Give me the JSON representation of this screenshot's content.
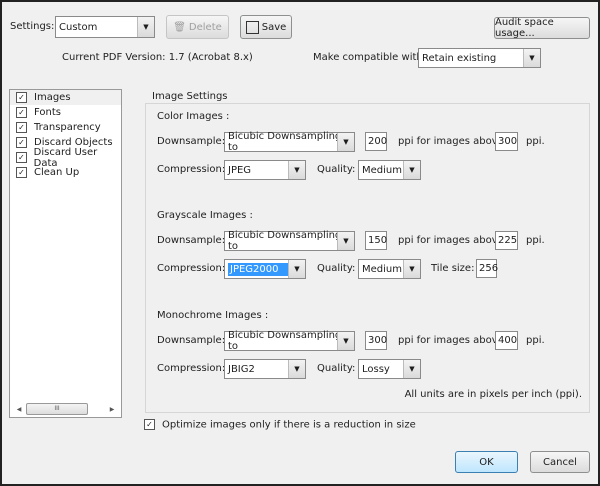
{
  "toolbar": {
    "settings_label": "Settings:",
    "settings_value": "Custom",
    "delete_label": "Delete",
    "save_label": "Save",
    "audit_label": "Audit space usage..."
  },
  "info": {
    "version": "Current PDF Version: 1.7 (Acrobat 8.x)",
    "compat_label": "Make compatible with:",
    "compat_value": "Retain existing"
  },
  "sidebar": {
    "items": [
      {
        "label": "Images",
        "checked": true
      },
      {
        "label": "Fonts",
        "checked": true
      },
      {
        "label": "Transparency",
        "checked": true
      },
      {
        "label": "Discard Objects",
        "checked": true
      },
      {
        "label": "Discard User Data",
        "checked": true
      },
      {
        "label": "Clean Up",
        "checked": true
      }
    ],
    "scroll_grip": "III"
  },
  "image_settings": {
    "legend": "Image Settings",
    "labels": {
      "downsample": "Downsample:",
      "compression": "Compression:",
      "quality": "Quality:",
      "ppi_above": "ppi for images above",
      "ppi": "ppi.",
      "tile_size": "Tile size:"
    },
    "color": {
      "title": "Color Images :",
      "downsample": "Bicubic Downsampling to",
      "ppi": "200",
      "above": "300",
      "compression": "JPEG",
      "quality": "Medium"
    },
    "grayscale": {
      "title": "Grayscale Images :",
      "downsample": "Bicubic Downsampling to",
      "ppi": "150",
      "above": "225",
      "compression": "JPEG2000",
      "quality": "Medium",
      "tile_size": "256"
    },
    "mono": {
      "title": "Monochrome Images :",
      "downsample": "Bicubic Downsampling to",
      "ppi": "300",
      "above": "400",
      "compression": "JBIG2",
      "quality": "Lossy"
    },
    "units_note": "All units are in pixels per inch (ppi)."
  },
  "optimize": {
    "label": "Optimize images only if there is a reduction in size",
    "checked": true
  },
  "buttons": {
    "ok": "OK",
    "cancel": "Cancel"
  },
  "colors": {
    "accent": "#3399ff",
    "ok_border": "#3c7fb1"
  }
}
